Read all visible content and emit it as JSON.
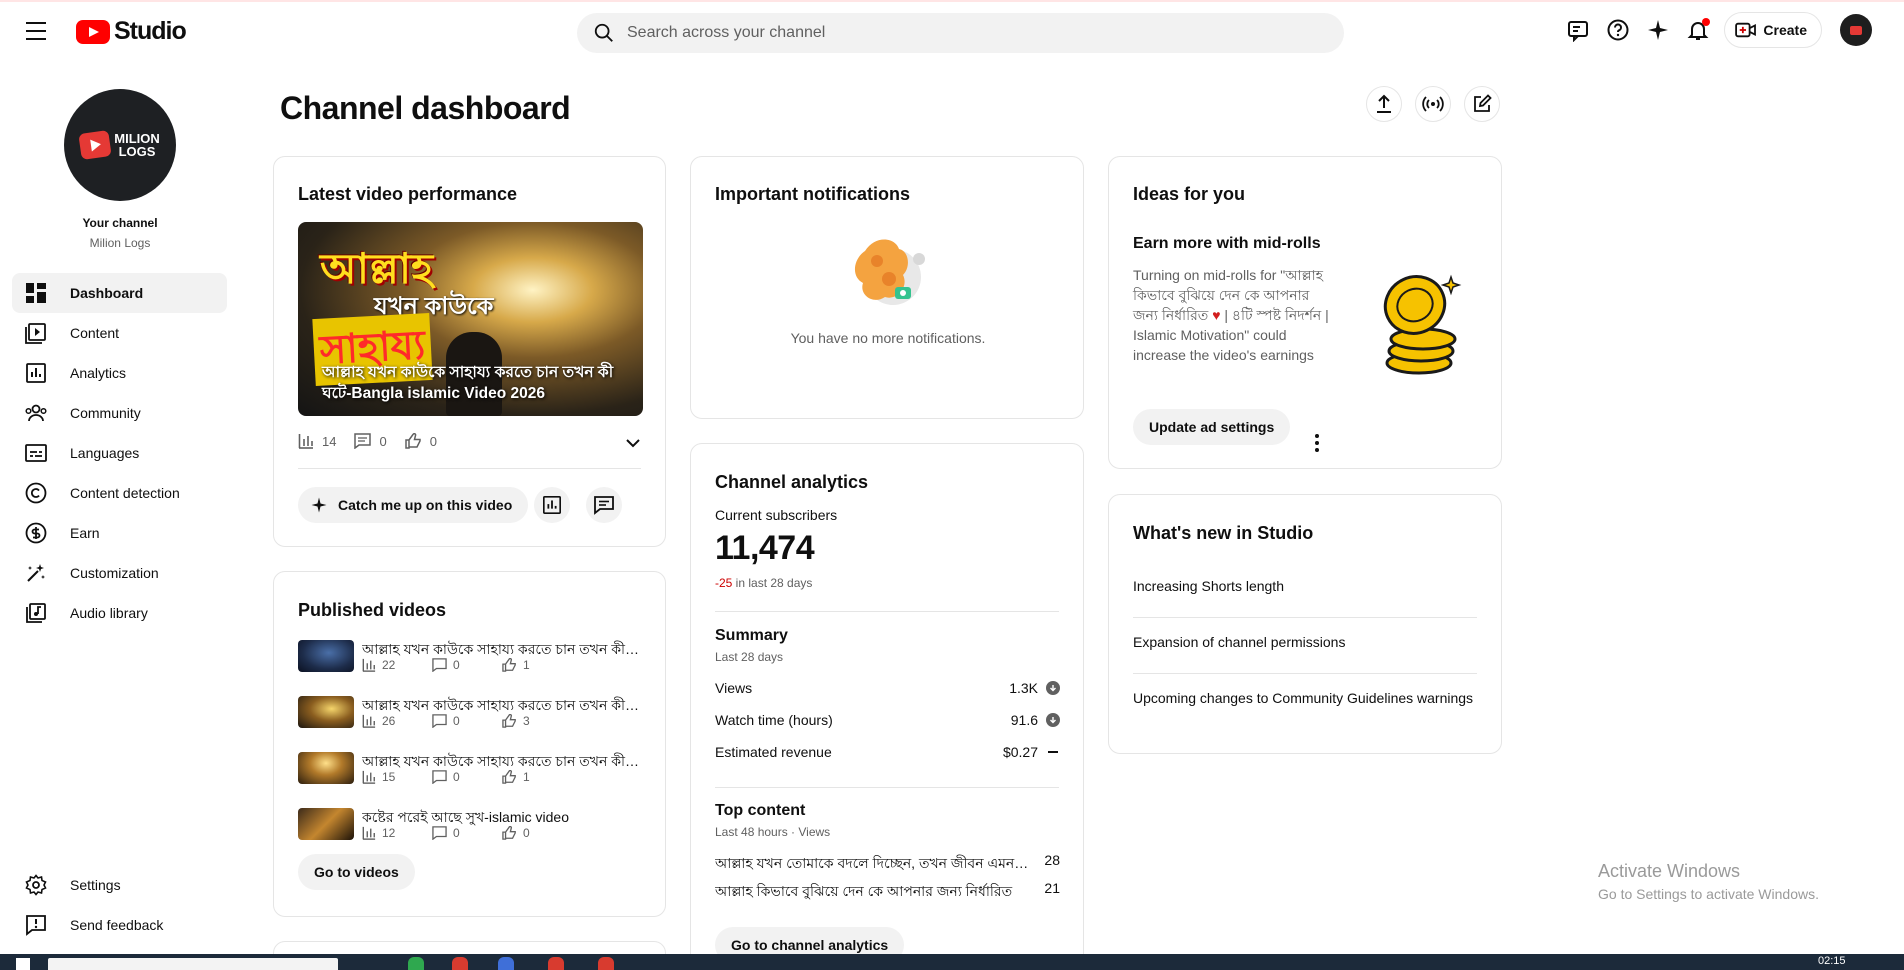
{
  "header": {
    "logo_text": "Studio",
    "search_placeholder": "Search across your channel",
    "create_label": "Create"
  },
  "sidebar": {
    "your_channel_label": "Your channel",
    "channel_name": "Milion Logs",
    "avatar_text_line1": "MILION",
    "avatar_text_line2": "LOGS",
    "items": [
      {
        "label": "Dashboard",
        "icon": "dashboard-icon"
      },
      {
        "label": "Content",
        "icon": "content-icon"
      },
      {
        "label": "Analytics",
        "icon": "analytics-icon"
      },
      {
        "label": "Community",
        "icon": "community-icon"
      },
      {
        "label": "Languages",
        "icon": "languages-icon"
      },
      {
        "label": "Content detection",
        "icon": "copyright-icon"
      },
      {
        "label": "Earn",
        "icon": "dollar-icon"
      },
      {
        "label": "Customization",
        "icon": "magic-wand-icon"
      },
      {
        "label": "Audio library",
        "icon": "audio-library-icon"
      }
    ],
    "bottom_items": [
      {
        "label": "Settings",
        "icon": "gear-icon"
      },
      {
        "label": "Send feedback",
        "icon": "feedback-icon"
      }
    ]
  },
  "page": {
    "title": "Channel dashboard"
  },
  "latest_video": {
    "title": "Latest video performance",
    "thumb_line1": "আল্লাহ",
    "thumb_line2": "যখন কাউকে",
    "thumb_line3": "সাহায্য",
    "caption": "আল্লাহ যখন কাউকে সাহায্য করতে চান তখন কী ঘটে-Bangla islamic Video 2026",
    "views": "14",
    "comments": "0",
    "likes": "0",
    "catch_up_label": "Catch me up on this video"
  },
  "published": {
    "title": "Published videos",
    "items": [
      {
        "title": "আল্লাহ যখন কাউকে সাহায্য করতে চান তখন কী ঘটে",
        "views": "22",
        "comments": "0",
        "likes": "1"
      },
      {
        "title": "আল্লাহ যখন কাউকে সাহায্য করতে চান তখন কী ঘটে",
        "views": "26",
        "comments": "0",
        "likes": "3"
      },
      {
        "title": "আল্লাহ যখন কাউকে সাহায্য করতে চান তখন কী ঘটে",
        "views": "15",
        "comments": "0",
        "likes": "1"
      },
      {
        "title": "কষ্টের পরেই আছে সুখ-islamic video",
        "views": "12",
        "comments": "0",
        "likes": "0"
      }
    ],
    "go_label": "Go to videos"
  },
  "notifications": {
    "title": "Important notifications",
    "empty_text": "You have no more notifications."
  },
  "analytics": {
    "title": "Channel analytics",
    "subs_label": "Current subscribers",
    "subs_value": "11,474",
    "subs_change": "-25",
    "subs_change_suffix": " in last 28 days",
    "summary_title": "Summary",
    "summary_period": "Last 28 days",
    "metrics": [
      {
        "label": "Views",
        "value": "1.3K"
      },
      {
        "label": "Watch time (hours)",
        "value": "91.6"
      },
      {
        "label": "Estimated revenue",
        "value": "$0.27"
      }
    ],
    "top_title": "Top content",
    "top_period": "Last 48 hours · Views",
    "top_items": [
      {
        "title": "আল্লাহ যখন তোমাকে বদলে দিচ্ছেন, তখন জীবন এমন মনে হয়",
        "value": "28"
      },
      {
        "title": "আল্লাহ কিভাবে বুঝিয়ে দেন কে আপনার জন্য নির্ধারিত",
        "value": "21"
      }
    ],
    "go_label": "Go to channel analytics"
  },
  "ideas": {
    "title": "Ideas for you",
    "idea_title": "Earn more with mid-rolls",
    "idea_body_1": "Turning on mid-rolls for \"আল্লাহ কিভাবে বুঝিয়ে দেন কে আপনার জন্য নির্ধারিত ",
    "idea_body_2": " | ৪টি স্পষ্ট নিদর্শন | Islamic Motivation\" could increase the video's earnings",
    "button_label": "Update ad settings"
  },
  "whats_new": {
    "title": "What's new in Studio",
    "items": [
      {
        "label": "Increasing Shorts length"
      },
      {
        "label": "Expansion of channel permissions"
      },
      {
        "label": "Upcoming changes to Community Guidelines warnings"
      }
    ]
  },
  "watermark": {
    "line1": "Activate Windows",
    "line2": "Go to Settings to activate Windows."
  },
  "taskbar": {
    "time": "02:15"
  },
  "colors": {
    "brand_red": "#ff0000",
    "negative": "#cc0000",
    "muted": "#606060",
    "border": "#e5e5e5",
    "chip": "#f2f2f2"
  }
}
